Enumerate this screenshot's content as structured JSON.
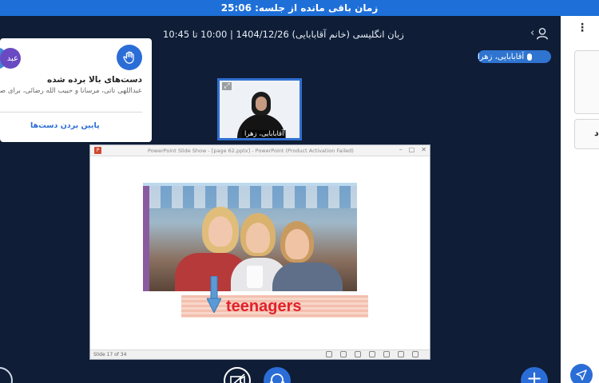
{
  "session": {
    "timer_text": "زمان باقی مانده از جلسه: 25:06",
    "meeting_title": "زبان انگلیسی (خانم آقابابایی) 1404/12/26 | 10:00 تا 10:45"
  },
  "talker": {
    "name": "آقابابایی، زهرا"
  },
  "raised_hands": {
    "avatar_initials": "عبد",
    "title": "دست‌های بالا برده شده",
    "description": "عبداللهی تاتی، مرسانا و حبیب الله رضائی، برای صحبت اجازه گرفتند",
    "lower_button_label": "پایین بردن دست‌ها"
  },
  "video": {
    "participant_name": "آقابابایی، زهرا"
  },
  "presentation": {
    "window_title": "PowerPoint Slide Show - [page 62.pptx] - PowerPoint (Product Activation Failed)",
    "slide_word": "teenagers",
    "slide_counter": "Slide 17 of 34"
  },
  "right_panel": {
    "card_letter": "د"
  },
  "colors": {
    "accent": "#2b6dd6",
    "background": "#0f1d36",
    "timer_bar": "#1e6fd8"
  },
  "icons": {
    "user": "user-icon",
    "hand": "raise-hand-icon",
    "mic": "microphone-icon",
    "camera_off": "camera-off-icon",
    "headset": "headset-icon",
    "plus": "plus-icon",
    "send": "send-icon",
    "menu": "kebab-menu-icon"
  }
}
